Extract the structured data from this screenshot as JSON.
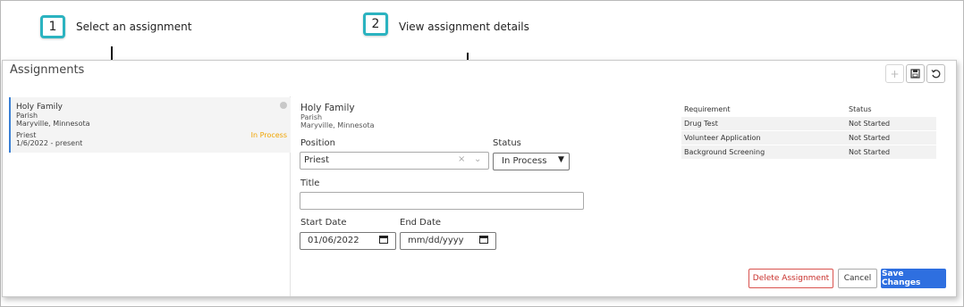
{
  "callouts": [
    {
      "number": "1",
      "text": "Select an assignment"
    },
    {
      "number": "2",
      "text": "View assignment details"
    }
  ],
  "panel": {
    "title": "Assignments",
    "toolbar": {
      "add_icon": "plus-icon",
      "save_icon": "save-icon",
      "refresh_icon": "refresh-icon"
    }
  },
  "assignment_item": {
    "name": "Holy Family",
    "type": "Parish",
    "location": "Maryville, Minnesota",
    "position": "Priest",
    "dates": "1/6/2022 - present",
    "status": "In Process"
  },
  "details": {
    "name": "Holy Family",
    "type": "Parish",
    "location": "Maryville, Minnesota",
    "position_label": "Position",
    "position_value": "Priest",
    "status_label": "Status",
    "status_value": "In Process",
    "title_label": "Title",
    "title_value": "",
    "start_date_label": "Start Date",
    "start_date_value": "01/06/2022",
    "end_date_label": "End Date",
    "end_date_placeholder": "mm/dd/yyyy"
  },
  "requirements": {
    "headers": [
      "Requirement",
      "Status"
    ],
    "rows": [
      [
        "Drug Test",
        "Not Started"
      ],
      [
        "Volunteer Application",
        "Not Started"
      ],
      [
        "Background Screening",
        "Not Started"
      ]
    ]
  },
  "buttons": {
    "delete": "Delete Assignment",
    "cancel": "Cancel",
    "save": "Save Changes"
  },
  "colors": {
    "accent": "#2e6fe0",
    "callout_border": "#2bb3c0",
    "status_in_process": "#f0a400",
    "delete": "#c9302c"
  }
}
